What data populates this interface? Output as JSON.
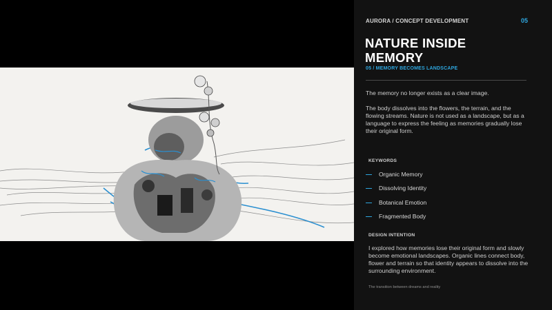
{
  "header": {
    "breadcrumb": "AURORA / CONCEPT DEVELOPMENT",
    "page_number": "05"
  },
  "title": {
    "line1": "NATURE INSIDE",
    "line2": "MEMORY",
    "subtitle": "05 / MEMORY BECOMES LANDSCAPE"
  },
  "body": {
    "paragraph1": "The memory no longer exists as a clear image.",
    "paragraph2": "The body dissolves into the flowers, the terrain, and the flowing streams. Nature is not used as a landscape, but as a language to express the feeling as memories gradually lose their original form."
  },
  "keywords": {
    "label": "KEYWORDS",
    "items": [
      {
        "label": "Organic Memory"
      },
      {
        "label": "Dissolving Identity"
      },
      {
        "label": "Botanical Emotion"
      },
      {
        "label": "Fragmented Body"
      }
    ]
  },
  "design_intention": {
    "label": "DESIGN INTENTION",
    "text": "I explored how memories lose their original form and slowly become emotional landscapes. Organic lines connect body, flower and terrain so that identity appears to dissolve into the surrounding environment."
  },
  "caption": "The transition between dreams and reality",
  "colors": {
    "accent": "#2ea7e0",
    "panel_background": "#121212",
    "artwork_background": "#f3f2ef"
  }
}
